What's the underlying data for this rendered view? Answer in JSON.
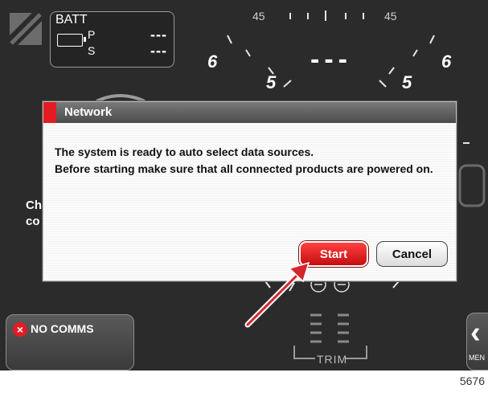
{
  "battery": {
    "title": "BATT",
    "p_label": "P",
    "s_label": "S",
    "p_value": "---",
    "s_value": "---"
  },
  "gauge": {
    "scale_left": "45",
    "scale_right": "45",
    "num_6_left": "6",
    "num_5_left": "5",
    "num_5_right": "5",
    "num_6_right": "6",
    "center_value": "---"
  },
  "side_text": {
    "line1": "Ch",
    "line2": "co"
  },
  "dialog": {
    "title": "Network",
    "line1": "The system is ready to auto select data sources.",
    "line2": "Before starting make sure that all connected products are powered on.",
    "start_label": "Start",
    "cancel_label": "Cancel"
  },
  "status": {
    "no_comms_label": "NO COMMS"
  },
  "trim": {
    "label": "TRIM"
  },
  "menu": {
    "label": "MEN"
  },
  "caption": "5676",
  "colors": {
    "accent_red": "#e31b23",
    "background": "#2b2b2b",
    "dialog_bg": "#f5f5f5"
  },
  "icons": [
    "slash-icon",
    "battery-icon",
    "no-comms-x-icon",
    "trim-tab-icon",
    "chevron-left-icon",
    "pointer-arrow-icon"
  ]
}
